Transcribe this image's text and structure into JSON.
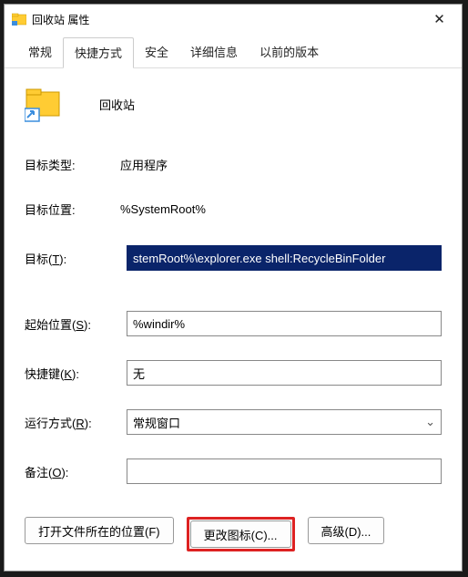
{
  "window": {
    "title": "回收站 属性",
    "close_glyph": "✕"
  },
  "tabs": [
    {
      "label": "常规"
    },
    {
      "label": "快捷方式"
    },
    {
      "label": "安全"
    },
    {
      "label": "详细信息"
    },
    {
      "label": "以前的版本"
    }
  ],
  "active_tab_index": 1,
  "shortcut": {
    "display_name": "回收站",
    "target_type_label": "目标类型:",
    "target_type_value": "应用程序",
    "target_location_label": "目标位置:",
    "target_location_value": "%SystemRoot%",
    "target_label_pre": "目标(",
    "target_label_u": "T",
    "target_label_post": "):",
    "target_value": "stemRoot%\\explorer.exe shell:RecycleBinFolder",
    "startin_label_pre": "起始位置(",
    "startin_label_u": "S",
    "startin_label_post": "):",
    "startin_value": "%windir%",
    "hotkey_label_pre": "快捷键(",
    "hotkey_label_u": "K",
    "hotkey_label_post": "):",
    "hotkey_value": "无",
    "run_label_pre": "运行方式(",
    "run_label_u": "R",
    "run_label_post": "):",
    "run_value": "常规窗口",
    "comment_label_pre": "备注(",
    "comment_label_u": "O",
    "comment_label_post": "):",
    "comment_value": ""
  },
  "buttons": {
    "open_location": "打开文件所在的位置(F)",
    "change_icon": "更改图标(C)...",
    "advanced": "高级(D)..."
  },
  "icons": {
    "folder_shortcut": "folder-shortcut-icon"
  }
}
